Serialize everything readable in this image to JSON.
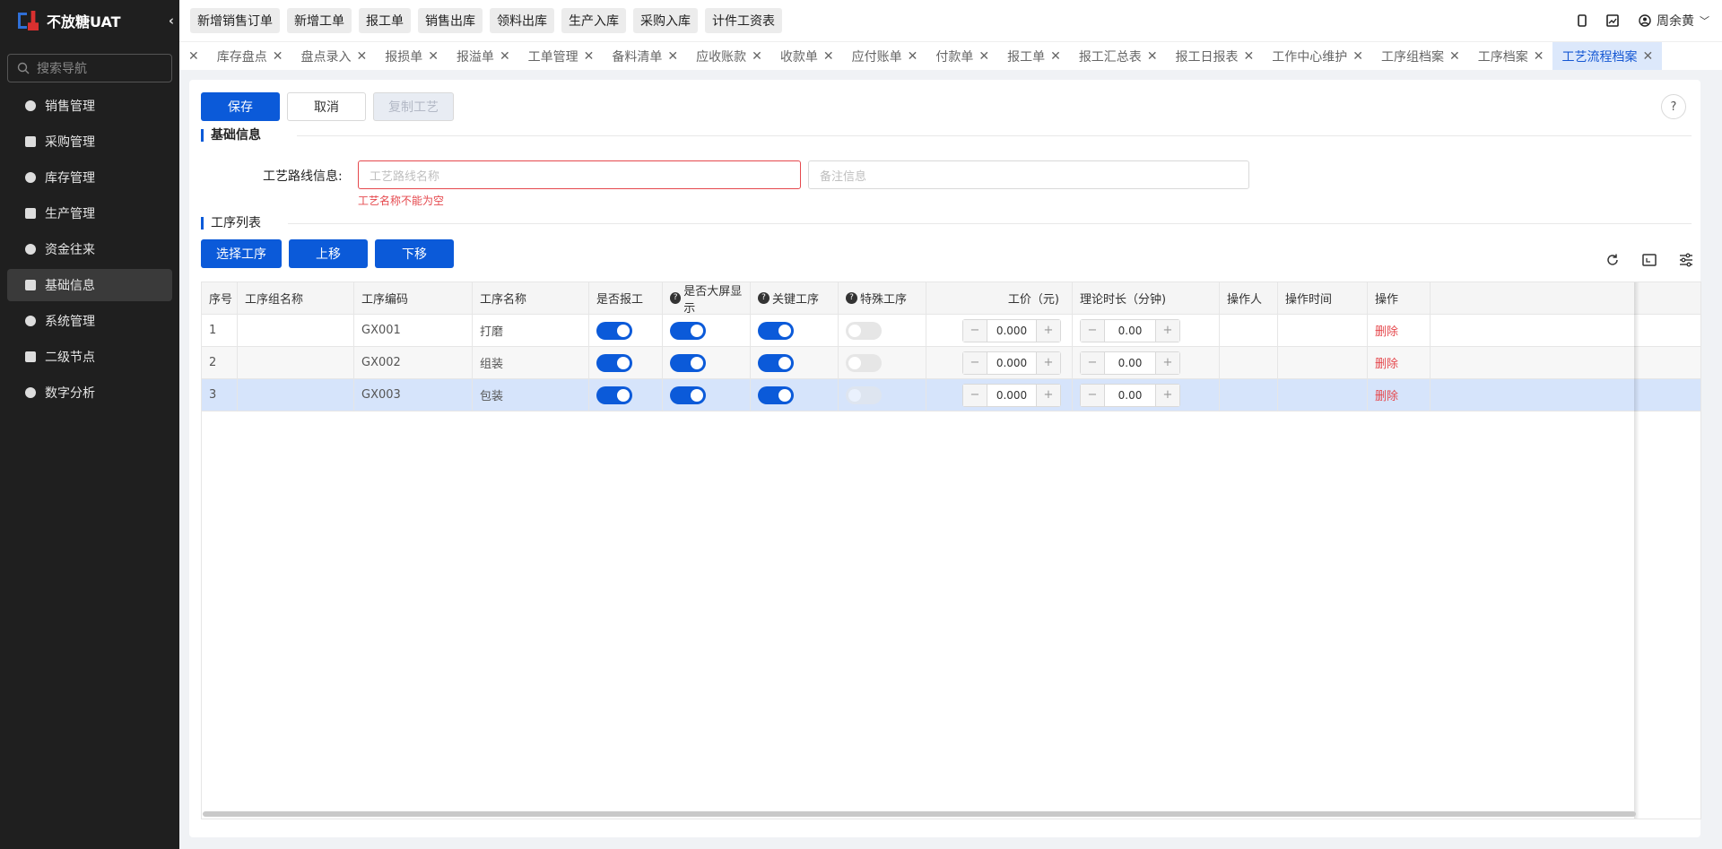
{
  "app": {
    "title": "不放糖UAT"
  },
  "sidebar": {
    "search_placeholder": "搜索导航",
    "items": [
      {
        "label": "销售管理",
        "icon": "tag-icon"
      },
      {
        "label": "采购管理",
        "icon": "cart-icon"
      },
      {
        "label": "库存管理",
        "icon": "warehouse-icon"
      },
      {
        "label": "生产管理",
        "icon": "factory-icon"
      },
      {
        "label": "资金往来",
        "icon": "money-icon"
      },
      {
        "label": "基础信息",
        "icon": "grid-icon",
        "active": true
      },
      {
        "label": "系统管理",
        "icon": "settings-icon"
      },
      {
        "label": "二级节点",
        "icon": "node-icon"
      },
      {
        "label": "数字分析",
        "icon": "pie-icon"
      }
    ]
  },
  "quick_actions": [
    "新增销售订单",
    "新增工单",
    "报工单",
    "销售出库",
    "领料出库",
    "生产入库",
    "采购入库",
    "计件工资表"
  ],
  "user": {
    "name": "周余黄"
  },
  "tabs": [
    "库存盘点",
    "盘点录入",
    "报损单",
    "报溢单",
    "工单管理",
    "备料清单",
    "应收账款",
    "收款单",
    "应付账单",
    "付款单",
    "报工单",
    "报工汇总表",
    "报工日报表",
    "工作中心维护",
    "工序组档案",
    "工序档案",
    "工艺流程档案"
  ],
  "form": {
    "save": "保存",
    "cancel": "取消",
    "copy": "复制工艺",
    "basic_section": "基础信息",
    "route_label": "工艺路线信息:",
    "route_placeholder": "工艺路线名称",
    "remark_placeholder": "备注信息",
    "route_error": "工艺名称不能为空",
    "process_section": "工序列表",
    "select_btn": "选择工序",
    "up_btn": "上移",
    "down_btn": "下移"
  },
  "table": {
    "headers": [
      "序号",
      "工序组名称",
      "工序编码",
      "工序名称",
      "是否报工",
      "是否大屏显示",
      "关键工序",
      "特殊工序",
      "工价（元)",
      "理论时长（分钟)",
      "操作人",
      "操作时间",
      "操作"
    ],
    "rows": [
      {
        "no": "1",
        "group": "",
        "code": "GX001",
        "name": "打磨",
        "report": true,
        "screen": true,
        "key": true,
        "special": false,
        "price": "0.000",
        "duration": "0.00",
        "operator": "",
        "time": "",
        "action": "删除"
      },
      {
        "no": "2",
        "group": "",
        "code": "GX002",
        "name": "组装",
        "report": true,
        "screen": true,
        "key": true,
        "special": false,
        "price": "0.000",
        "duration": "0.00",
        "operator": "",
        "time": "",
        "action": "删除"
      },
      {
        "no": "3",
        "group": "",
        "code": "GX003",
        "name": "包装",
        "report": true,
        "screen": true,
        "key": true,
        "special": false,
        "price": "0.000",
        "duration": "0.00",
        "operator": "",
        "time": "",
        "action": "删除"
      }
    ]
  }
}
